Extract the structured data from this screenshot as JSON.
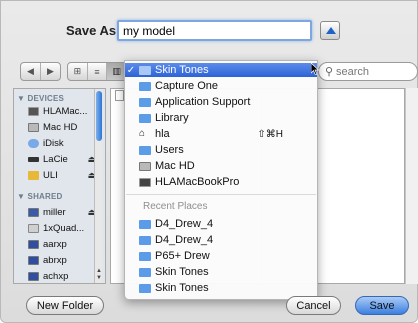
{
  "dialog": {
    "save_as_label": "Save As:",
    "filename_value": "my model"
  },
  "toolbar": {
    "nav": [
      "◀",
      "▶"
    ],
    "view": [
      "⊞",
      "≡",
      "▥"
    ],
    "search_placeholder": "search"
  },
  "sidebar": {
    "devices_header": "▼ DEVICES",
    "shared_header": "▼ SHARED",
    "devices": [
      {
        "label": "HLAMac...",
        "icon": "display-icon",
        "eject": ""
      },
      {
        "label": "Mac HD",
        "icon": "harddisk-icon",
        "eject": ""
      },
      {
        "label": "iDisk",
        "icon": "idisk-icon",
        "eject": ""
      },
      {
        "label": "LaCie",
        "icon": "external-drive-icon",
        "eject": "⏏"
      },
      {
        "label": "ULI",
        "icon": "drive-icon",
        "eject": "⏏"
      }
    ],
    "shared": [
      {
        "label": "miller",
        "icon": "computer-icon",
        "eject": "⏏"
      },
      {
        "label": "1xQuad...",
        "icon": "computer-icon",
        "eject": ""
      },
      {
        "label": "aarxp",
        "icon": "computer-icon",
        "eject": ""
      },
      {
        "label": "abrxp",
        "icon": "computer-icon",
        "eject": ""
      },
      {
        "label": "achxp",
        "icon": "computer-icon",
        "eject": ""
      }
    ]
  },
  "menu": {
    "selected": {
      "check": "✓",
      "label": "Skin Tones"
    },
    "items": [
      {
        "label": "Capture One",
        "icon": "folder-icon",
        "shortcut": ""
      },
      {
        "label": "Application Support",
        "icon": "folder-icon",
        "shortcut": ""
      },
      {
        "label": "Library",
        "icon": "folder-icon",
        "shortcut": ""
      },
      {
        "label": "hla",
        "icon": "home-icon",
        "shortcut": "⇧⌘H"
      },
      {
        "label": "Users",
        "icon": "folder-icon",
        "shortcut": ""
      },
      {
        "label": "Mac HD",
        "icon": "harddisk-icon",
        "shortcut": ""
      },
      {
        "label": "HLAMacBookPro",
        "icon": "display-icon",
        "shortcut": ""
      }
    ],
    "recent_header": "Recent Places",
    "recent": [
      {
        "label": "D4_Drew_4"
      },
      {
        "label": "D4_Drew_4"
      },
      {
        "label": "P65+ Drew"
      },
      {
        "label": "Skin Tones"
      },
      {
        "label": "Skin Tones"
      }
    ]
  },
  "buttons": {
    "new_folder": "New Folder",
    "cancel": "Cancel",
    "save": "Save"
  },
  "colors": {
    "accent": "#2d62d6",
    "folder": "#5b9be8"
  }
}
